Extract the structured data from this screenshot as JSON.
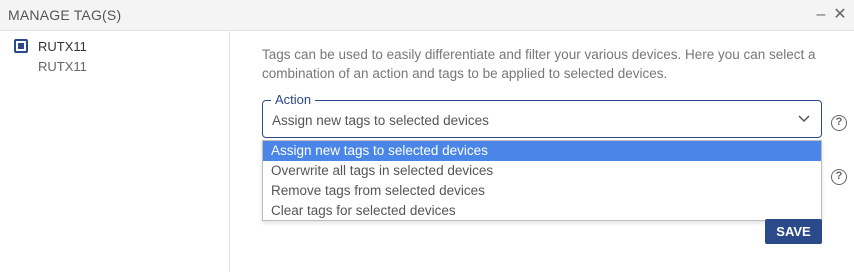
{
  "window": {
    "title": "MANAGE TAG(S)",
    "minimize_icon": "minimize-icon",
    "close_icon": "close-icon"
  },
  "devices": [
    {
      "name": "RUTX11",
      "subtitle": "RUTX11",
      "checked": true
    }
  ],
  "description": "Tags can be used to easily differentiate and filter your various devices. Here you can select a combination of an action and tags to be applied to selected devices.",
  "action_field": {
    "label": "Action",
    "value": "Assign new tags to selected devices",
    "options": [
      "Assign new tags to selected devices",
      "Overwrite all tags in selected devices",
      "Remove tags from selected devices",
      "Clear tags for selected devices"
    ],
    "selected_index": 0
  },
  "help_label": "?",
  "buttons": {
    "save": "SAVE"
  },
  "colors": {
    "accent": "#2b4a8a",
    "highlight": "#4a86e8"
  }
}
